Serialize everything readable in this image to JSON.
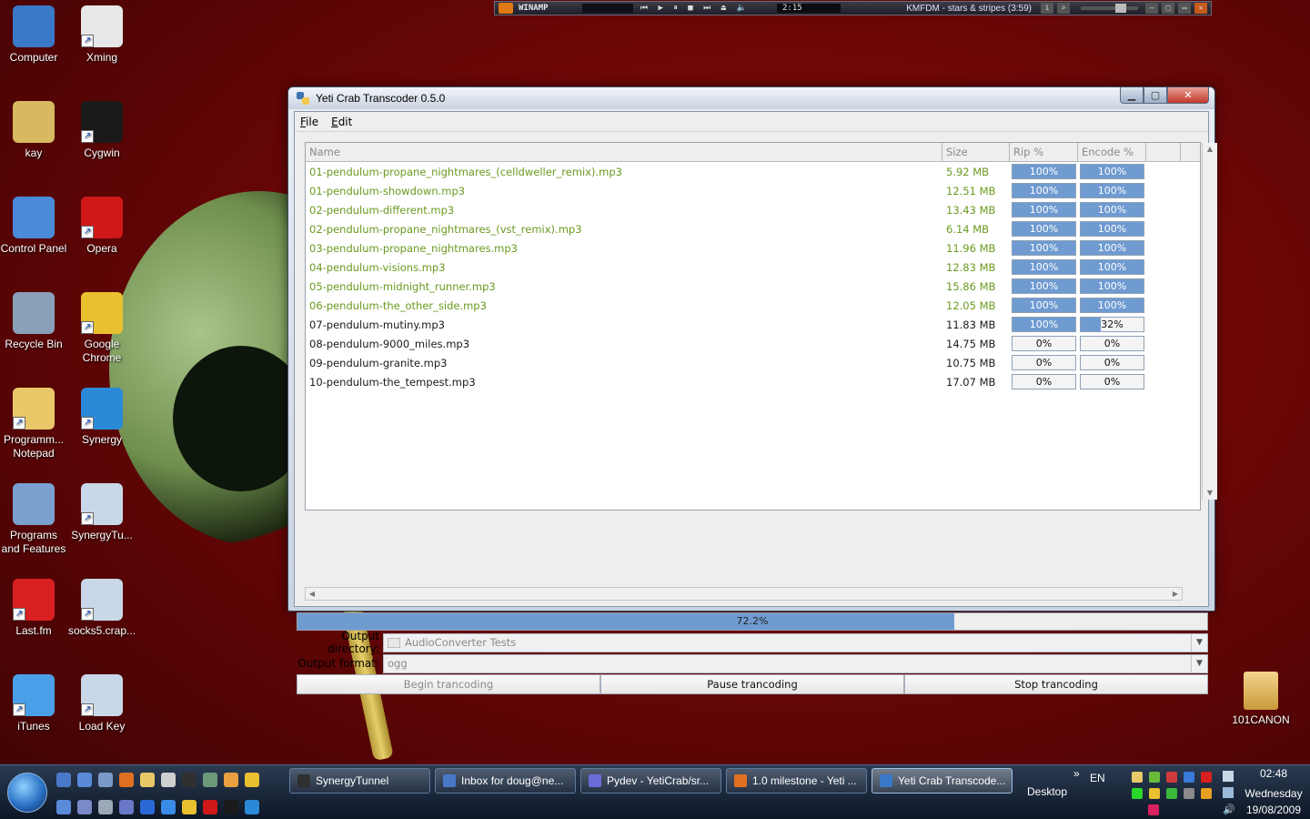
{
  "desktop": {
    "icons_left": [
      {
        "label": "Computer",
        "color": "#3a78c8"
      },
      {
        "label": "Xming",
        "color": "#e8e8e8"
      },
      {
        "label": "kay",
        "color": "#d8b860"
      },
      {
        "label": "Cygwin",
        "color": "#1a1a1a"
      },
      {
        "label": "Control Panel",
        "color": "#4a8ad8"
      },
      {
        "label": "Opera",
        "color": "#d01818"
      },
      {
        "label": "Recycle Bin",
        "color": "#8aa0b8"
      },
      {
        "label": "Google Chrome",
        "color": "#e8c030"
      },
      {
        "label": "Programm... Notepad",
        "color": "#e8c868"
      },
      {
        "label": "Synergy",
        "color": "#2a8ad8"
      },
      {
        "label": "Programs and Features",
        "color": "#7aa0d0"
      },
      {
        "label": "SynergyTu...",
        "color": "#c8d8e8"
      },
      {
        "label": "Last.fm",
        "color": "#d82020"
      },
      {
        "label": "socks5.crap...",
        "color": "#c8d8e8"
      },
      {
        "label": "iTunes",
        "color": "#4aa0e8"
      },
      {
        "label": "Load Key",
        "color": "#c8d8e8"
      }
    ],
    "folder_right": "101CANON"
  },
  "winamp": {
    "name": "WINAMP",
    "time": "2:15",
    "track": "KMFDM - stars & stripes (3:59)"
  },
  "window": {
    "title": "Yeti Crab Transcoder 0.5.0",
    "menu": [
      "File",
      "Edit"
    ],
    "table": {
      "headers": [
        "Name",
        "Size",
        "Rip %",
        "Encode %"
      ],
      "rows": [
        {
          "name": "01-pendulum-propane_nightmares_(celldweller_remix).mp3",
          "size": "5.92 MB",
          "rip": "100%",
          "rip_pct": 100,
          "enc": "100%",
          "enc_pct": 100
        },
        {
          "name": "01-pendulum-showdown.mp3",
          "size": "12.51 MB",
          "rip": "100%",
          "rip_pct": 100,
          "enc": "100%",
          "enc_pct": 100
        },
        {
          "name": "02-pendulum-different.mp3",
          "size": "13.43 MB",
          "rip": "100%",
          "rip_pct": 100,
          "enc": "100%",
          "enc_pct": 100
        },
        {
          "name": "02-pendulum-propane_nightmares_(vst_remix).mp3",
          "size": "6.14 MB",
          "rip": "100%",
          "rip_pct": 100,
          "enc": "100%",
          "enc_pct": 100
        },
        {
          "name": "03-pendulum-propane_nightmares.mp3",
          "size": "11.96 MB",
          "rip": "100%",
          "rip_pct": 100,
          "enc": "100%",
          "enc_pct": 100
        },
        {
          "name": "04-pendulum-visions.mp3",
          "size": "12.83 MB",
          "rip": "100%",
          "rip_pct": 100,
          "enc": "100%",
          "enc_pct": 100
        },
        {
          "name": "05-pendulum-midnight_runner.mp3",
          "size": "15.86 MB",
          "rip": "100%",
          "rip_pct": 100,
          "enc": "100%",
          "enc_pct": 100
        },
        {
          "name": "06-pendulum-the_other_side.mp3",
          "size": "12.05 MB",
          "rip": "100%",
          "rip_pct": 100,
          "enc": "100%",
          "enc_pct": 100
        },
        {
          "name": "07-pendulum-mutiny.mp3",
          "size": "11.83 MB",
          "rip": "100%",
          "rip_pct": 100,
          "enc": "32%",
          "enc_pct": 32
        },
        {
          "name": "08-pendulum-9000_miles.mp3",
          "size": "14.75 MB",
          "rip": "0%",
          "rip_pct": 0,
          "enc": "0%",
          "enc_pct": 0
        },
        {
          "name": "09-pendulum-granite.mp3",
          "size": "10.75 MB",
          "rip": "0%",
          "rip_pct": 0,
          "enc": "0%",
          "enc_pct": 0
        },
        {
          "name": "10-pendulum-the_tempest.mp3",
          "size": "17.07 MB",
          "rip": "0%",
          "rip_pct": 0,
          "enc": "0%",
          "enc_pct": 0
        }
      ]
    },
    "overall_progress": {
      "label": "72.2%",
      "value": 72.2
    },
    "output_directory": {
      "label": "Output directory:",
      "value": "AudioConverter Tests"
    },
    "output_format": {
      "label": "Output format:",
      "value": "ogg"
    },
    "buttons": {
      "begin": "Begin trancoding",
      "pause": "Pause trancoding",
      "stop": "Stop trancoding"
    },
    "colors": {
      "done_text": "#6a9a1f",
      "progress_fill": "#6f9bd1"
    }
  },
  "taskbar": {
    "tasks": [
      {
        "label": "SynergyTunnel",
        "color": "#303030"
      },
      {
        "label": "Inbox for doug@ne...",
        "color": "#4a78c8"
      },
      {
        "label": "Pydev - YetiCrab/sr...",
        "color": "#6a6ad8"
      },
      {
        "label": "1.0 milestone - Yeti ...",
        "color": "#e07020"
      },
      {
        "label": "Yeti Crab Transcode...",
        "color": "#3a78c8",
        "active": true
      }
    ],
    "desktop_label": "Desktop",
    "chevron": "»",
    "language": "EN",
    "clock": {
      "time": "02:48",
      "day": "Wednesday",
      "date": "19/08/2009"
    }
  }
}
